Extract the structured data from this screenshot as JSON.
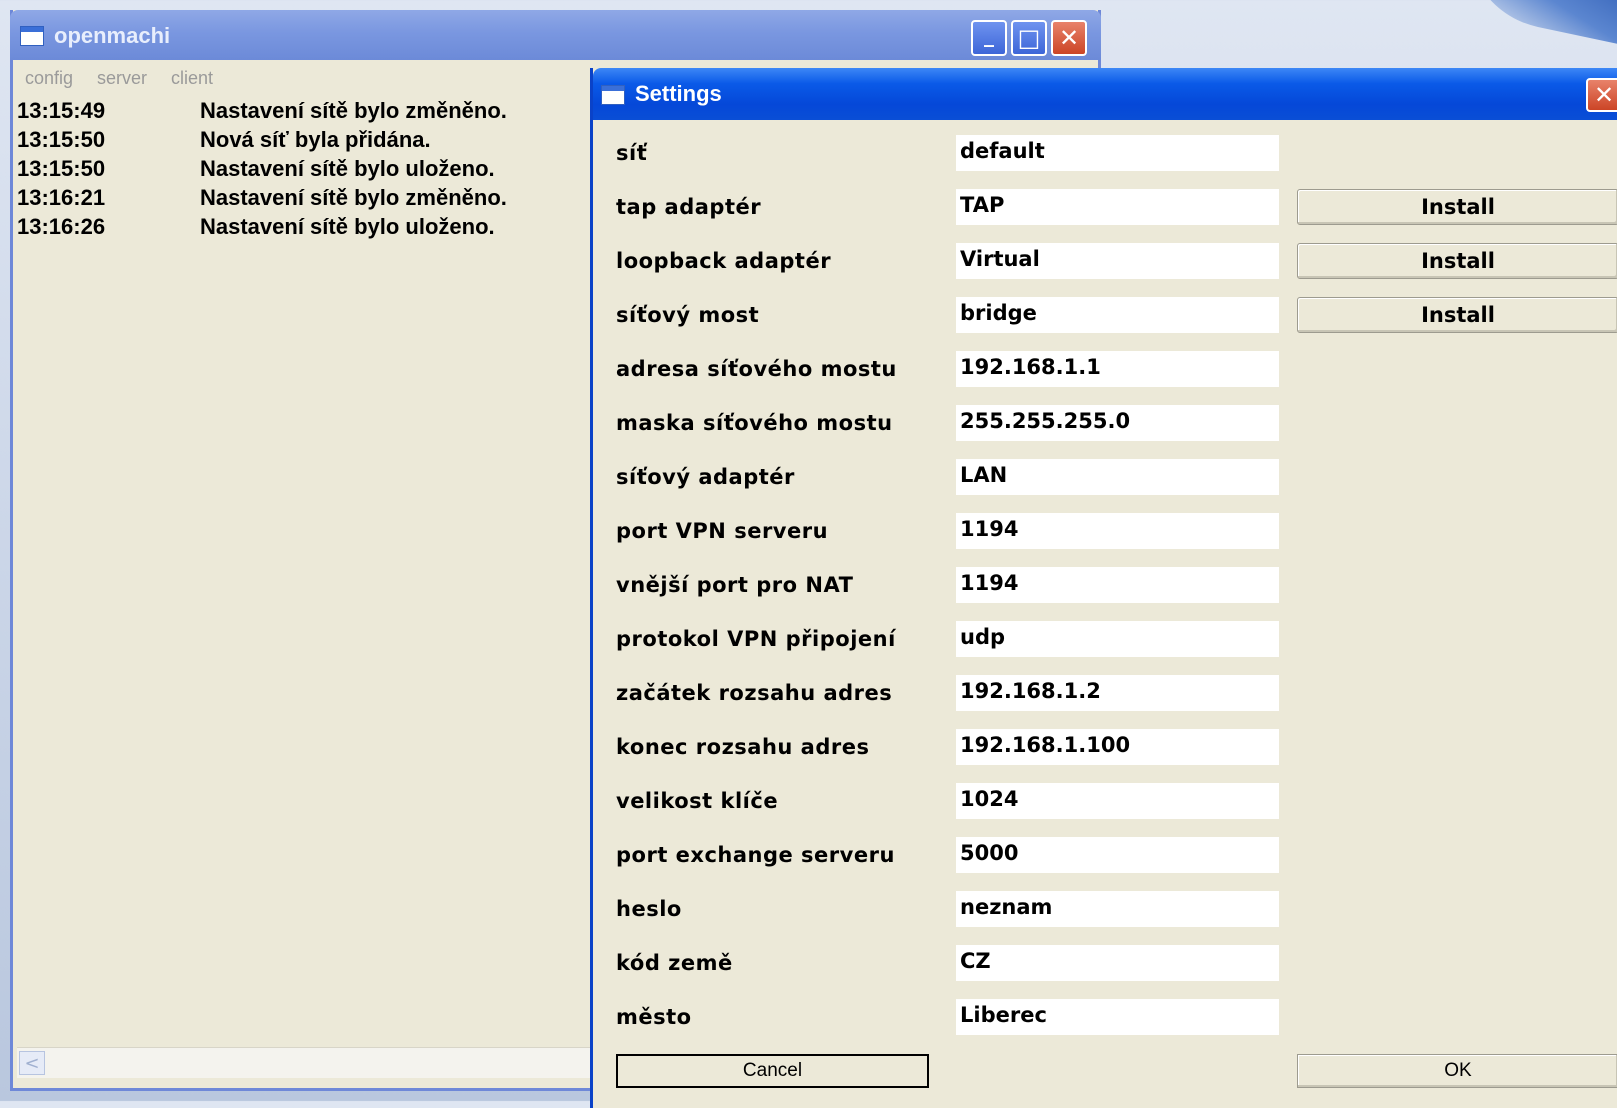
{
  "main_window": {
    "title": "openmachi",
    "controls": {
      "minimize": "_",
      "maximize": "□",
      "close": "✕"
    },
    "menu": [
      "config",
      "server",
      "client"
    ],
    "log": [
      {
        "time": "13:15:49",
        "message": "Nastavení sítě bylo změněno."
      },
      {
        "time": "13:15:50",
        "message": "Nová síť byla přidána."
      },
      {
        "time": "13:15:50",
        "message": "Nastavení sítě bylo uloženo."
      },
      {
        "time": "13:16:21",
        "message": "Nastavení sítě bylo změněno."
      },
      {
        "time": "13:16:26",
        "message": "Nastavení sítě bylo uloženo."
      }
    ],
    "scroll_left": "<"
  },
  "settings": {
    "title": "Settings",
    "close": "✕",
    "fields": [
      {
        "label": "síť",
        "value": "default"
      },
      {
        "label": "tap adaptér",
        "value": "TAP",
        "button": "Install"
      },
      {
        "label": "loopback adaptér",
        "value": "Virtual",
        "button": "Install"
      },
      {
        "label": "síťový most",
        "value": "bridge",
        "button": "Install"
      },
      {
        "label": "adresa síťového mostu",
        "value": "192.168.1.1"
      },
      {
        "label": "maska síťového mostu",
        "value": "255.255.255.0"
      },
      {
        "label": "síťový adaptér",
        "value": "LAN"
      },
      {
        "label": "port VPN serveru",
        "value": "1194"
      },
      {
        "label": "vnější port pro NAT",
        "value": "1194"
      },
      {
        "label": "protokol VPN připojení",
        "value": "udp"
      },
      {
        "label": "začátek rozsahu adres",
        "value": "192.168.1.2"
      },
      {
        "label": "konec rozsahu adres",
        "value": "192.168.1.100"
      },
      {
        "label": "velikost klíče",
        "value": "1024"
      },
      {
        "label": "port exchange serveru",
        "value": "5000"
      },
      {
        "label": "heslo",
        "value": "neznam"
      },
      {
        "label": "kód země",
        "value": "CZ"
      },
      {
        "label": "město",
        "value": "Liberec"
      }
    ],
    "cancel_label": "Cancel",
    "ok_label": "OK"
  },
  "colors": {
    "window_bg": "#ece9d8",
    "title_active": "#0548d8",
    "title_inactive": "#7a97e0",
    "close_red": "#cc4526"
  }
}
